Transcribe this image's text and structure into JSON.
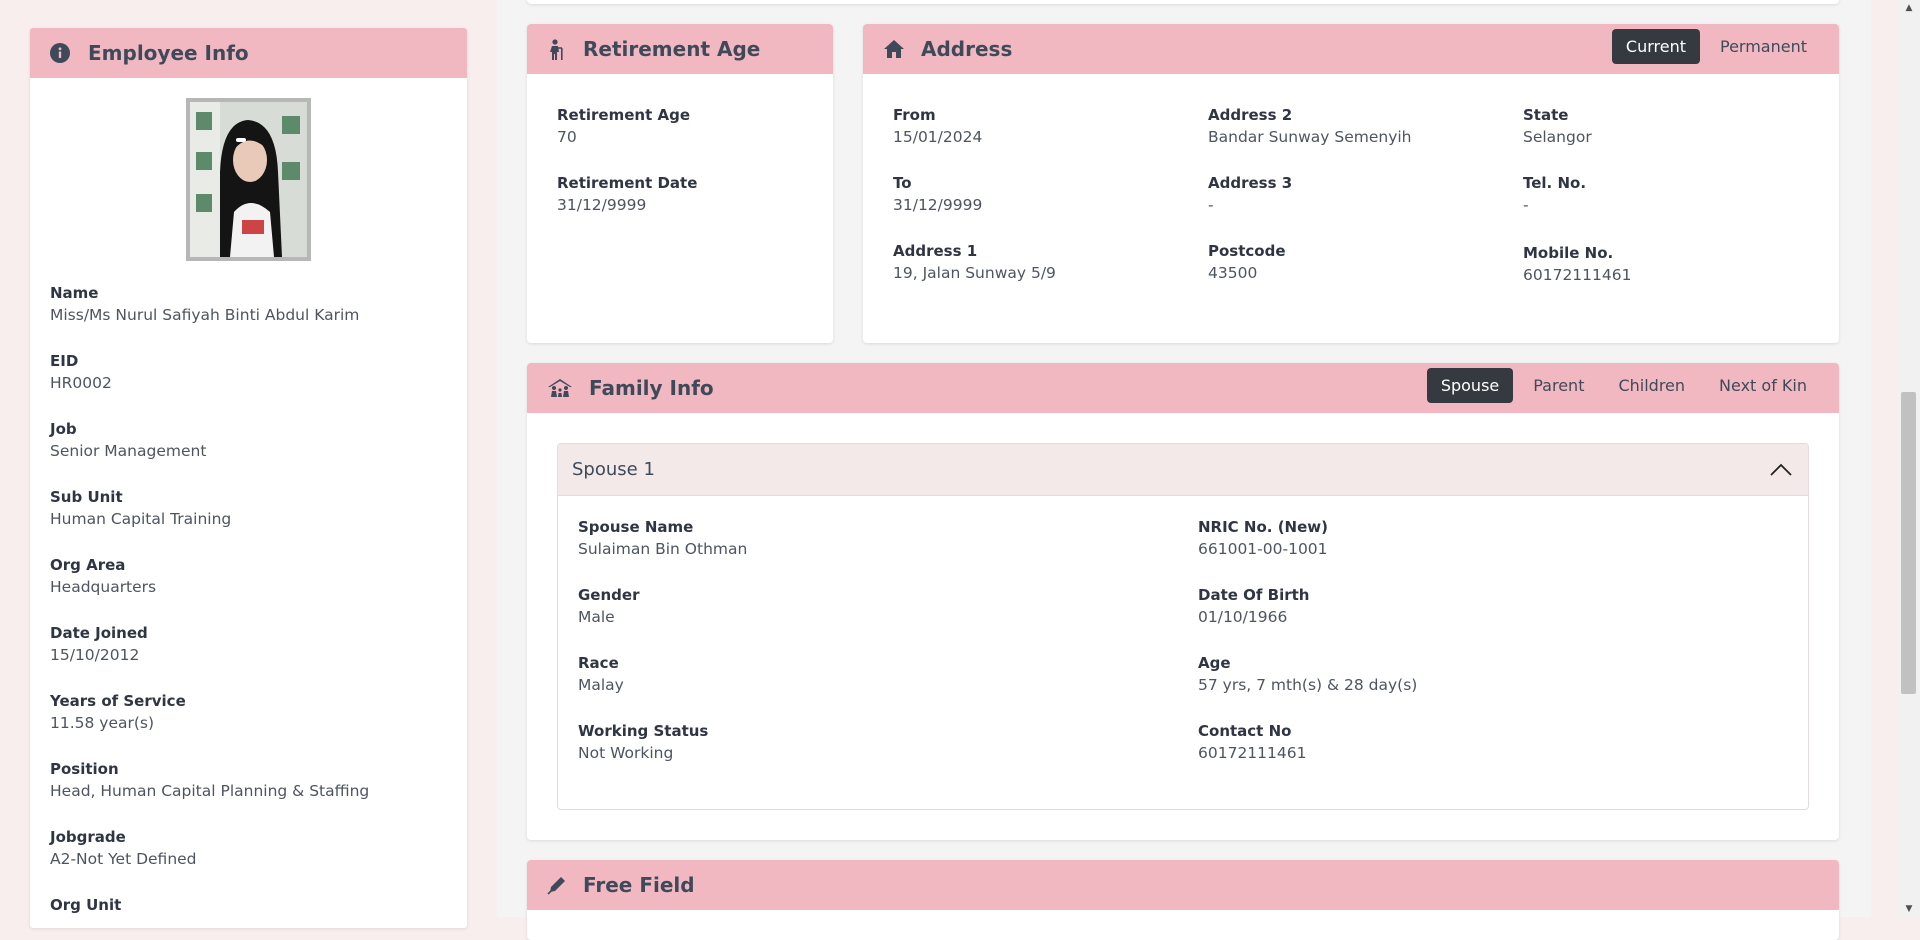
{
  "employee_info": {
    "title": "Employee Info",
    "fields": [
      {
        "label": "Name",
        "value": "Miss/Ms Nurul Safiyah Binti Abdul Karim"
      },
      {
        "label": "EID",
        "value": "HR0002"
      },
      {
        "label": "Job",
        "value": "Senior Management"
      },
      {
        "label": "Sub Unit",
        "value": "Human Capital Training"
      },
      {
        "label": "Org Area",
        "value": "Headquarters"
      },
      {
        "label": "Date Joined",
        "value": "15/10/2012"
      },
      {
        "label": "Years of Service",
        "value": "11.58 year(s)"
      },
      {
        "label": "Position",
        "value": "Head, Human Capital Planning & Staffing"
      },
      {
        "label": "Jobgrade",
        "value": "A2-Not Yet Defined"
      },
      {
        "label": "Org Unit",
        "value": ""
      }
    ]
  },
  "retirement": {
    "title": "Retirement Age",
    "age_label": "Retirement Age",
    "age_value": "70",
    "date_label": "Retirement Date",
    "date_value": "31/12/9999"
  },
  "address": {
    "title": "Address",
    "tabs": [
      "Current",
      "Permanent"
    ],
    "from_label": "From",
    "from_value": "15/01/2024",
    "to_label": "To",
    "to_value": "31/12/9999",
    "addr1_label": "Address 1",
    "addr1_value": "19, Jalan Sunway 5/9",
    "addr2_label": "Address 2",
    "addr2_value": "Bandar Sunway Semenyih",
    "addr3_label": "Address 3",
    "addr3_value": "-",
    "postcode_label": "Postcode",
    "postcode_value": "43500",
    "state_label": "State",
    "state_value": "Selangor",
    "tel_label": "Tel. No.",
    "tel_value": "-",
    "mobile_label": "Mobile No.",
    "mobile_value": "60172111461"
  },
  "family": {
    "title": "Family Info",
    "tabs": [
      "Spouse",
      "Parent",
      "Children",
      "Next of Kin"
    ],
    "accordion_title": "Spouse 1",
    "spouse_name_label": "Spouse Name",
    "spouse_name_value": "Sulaiman Bin Othman",
    "gender_label": "Gender",
    "gender_value": "Male",
    "race_label": "Race",
    "race_value": "Malay",
    "working_label": "Working Status",
    "working_value": "Not Working",
    "nric_label": "NRIC No. (New)",
    "nric_value": "661001-00-1001",
    "dob_label": "Date Of Birth",
    "dob_value": "01/10/1966",
    "age_label": "Age",
    "age_value": "57 yrs, 7 mth(s) & 28 day(s)",
    "contact_label": "Contact No",
    "contact_value": "60172111461"
  },
  "free_field": {
    "title": "Free Field"
  },
  "colors": {
    "header_pink": "#f2b8c1",
    "active_tab": "#343a40",
    "accordion_bg": "#f3e9e8"
  }
}
